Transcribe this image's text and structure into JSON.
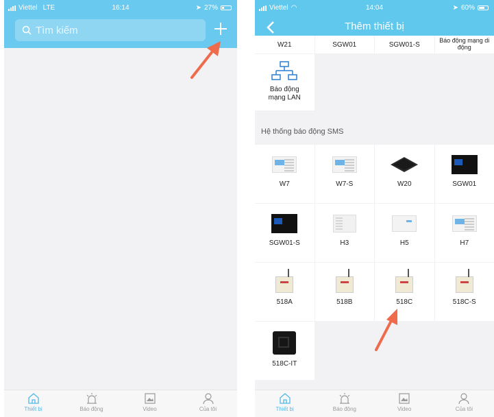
{
  "left": {
    "status": {
      "carrier": "Viettel",
      "network": "LTE",
      "time": "16:14",
      "battery": "27%"
    },
    "search": {
      "placeholder": "Tìm kiếm"
    },
    "tabs": [
      {
        "label": "Thiết bị",
        "icon": "home-icon",
        "active": true
      },
      {
        "label": "Báo động",
        "icon": "alarm-icon",
        "active": false
      },
      {
        "label": "Video",
        "icon": "video-icon",
        "active": false
      },
      {
        "label": "Của tôi",
        "icon": "user-icon",
        "active": false
      }
    ]
  },
  "right": {
    "status": {
      "carrier": "Viettel",
      "time": "14:04",
      "battery": "60%"
    },
    "title": "Thêm thiết bị",
    "top_row": [
      "W21",
      "SGW01",
      "SGW01-S",
      "Báo động mạng di động"
    ],
    "lan_device": {
      "name": "Báo động mạng LAN",
      "icon": "network-icon"
    },
    "section": "Hệ thống báo động SMS",
    "sms_devices": [
      {
        "name": "W7",
        "icon": "alarm-panel-icon"
      },
      {
        "name": "W7-S",
        "icon": "alarm-panel-icon"
      },
      {
        "name": "W20",
        "icon": "hub-icon"
      },
      {
        "name": "SGW01",
        "icon": "dark-panel-icon"
      },
      {
        "name": "SGW01-S",
        "icon": "dark-panel-icon"
      },
      {
        "name": "H3",
        "icon": "keypad-icon"
      },
      {
        "name": "H5",
        "icon": "keypad-icon"
      },
      {
        "name": "H7",
        "icon": "alarm-panel-icon"
      },
      {
        "name": "518A",
        "icon": "antenna-box-icon"
      },
      {
        "name": "518B",
        "icon": "antenna-box-icon"
      },
      {
        "name": "518C",
        "icon": "antenna-box-icon"
      },
      {
        "name": "518C-S",
        "icon": "antenna-box-icon"
      },
      {
        "name": "518C-IT",
        "icon": "black-box-icon"
      }
    ],
    "tabs": [
      {
        "label": "Thiết bị",
        "icon": "home-icon",
        "active": true
      },
      {
        "label": "Báo động",
        "icon": "alarm-icon",
        "active": false
      },
      {
        "label": "Video",
        "icon": "video-icon",
        "active": false
      },
      {
        "label": "Của tôi",
        "icon": "user-icon",
        "active": false
      }
    ]
  },
  "colors": {
    "header": "#5fc8ec",
    "accent": "#4fb7e6",
    "arrow": "#ee6b4d"
  }
}
